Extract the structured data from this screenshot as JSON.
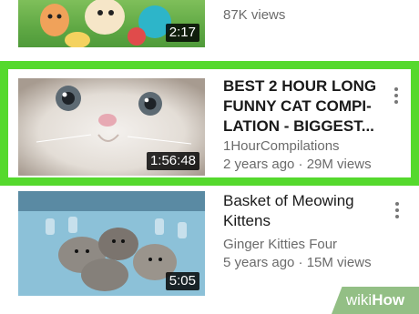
{
  "videos": [
    {
      "title": "",
      "channel": "",
      "stats": "87K views",
      "duration": "2:17"
    },
    {
      "title": "BEST 2 HOUR LONG FUNNY CAT COMPI-LATION - BIGGEST...",
      "title_lines": [
        "BEST 2 HOUR LONG",
        "FUNNY CAT COMPI-",
        "LATION - BIGGEST..."
      ],
      "channel": "1HourCompilations",
      "stats": "2 years ago · 29M views",
      "duration": "1:56:48"
    },
    {
      "title_lines": [
        "Basket of Meowing",
        "Kittens"
      ],
      "channel": "Ginger Kitties Four",
      "stats": "5 years ago · 15M views",
      "duration": "5:05"
    }
  ],
  "watermark": {
    "prefix": "wiki",
    "suffix": "How"
  },
  "colors": {
    "highlight": "#55d92d",
    "watermark": "#93bf85"
  }
}
